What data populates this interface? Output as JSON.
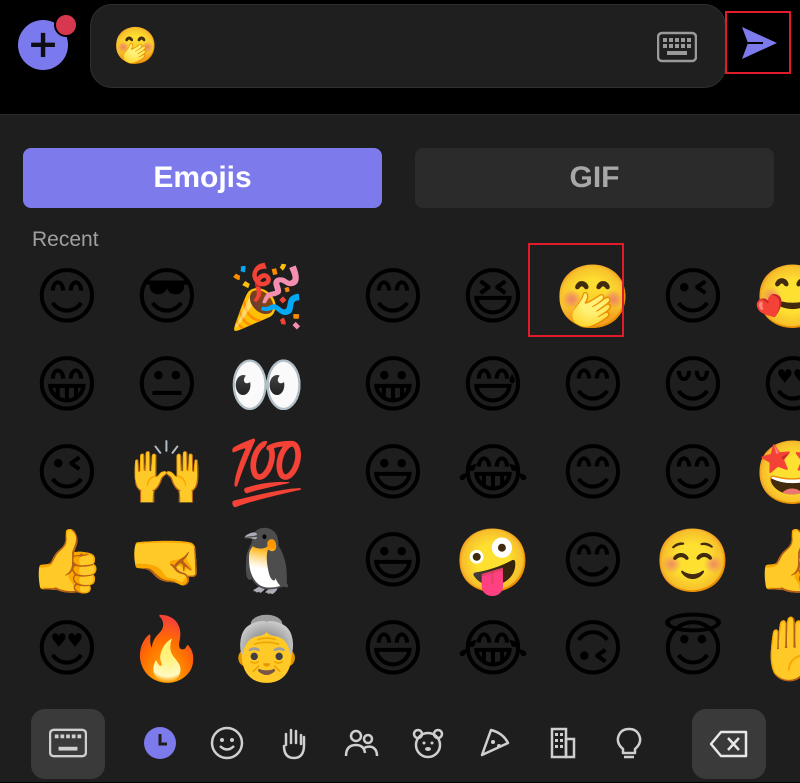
{
  "composer": {
    "input_value": "🤭",
    "icons": {
      "add": "plus-icon",
      "keyboard": "keyboard-icon",
      "send": "send-icon"
    }
  },
  "panel": {
    "tabs": [
      {
        "label": "Emojis",
        "active": true
      },
      {
        "label": "GIF",
        "active": false
      }
    ],
    "section_label": "Recent",
    "emoji_rows": [
      [
        "😊",
        "😎",
        "🎉",
        "😊",
        "😆",
        "🤭",
        "😉",
        "🥰"
      ],
      [
        "😁",
        "😐",
        "👀",
        "😀",
        "😅",
        "😊",
        "😌",
        "😍"
      ],
      [
        "😉",
        "🙌",
        "💯",
        "😃",
        "😂",
        "😊",
        "😊",
        "🤩"
      ],
      [
        "👍",
        "🤜",
        "🐧",
        "😃",
        "🤪",
        "😊",
        "☺️",
        "👍"
      ],
      [
        "😍",
        "🔥",
        "👵",
        "😄",
        "😂",
        "🙃",
        "😇",
        "✋"
      ]
    ],
    "selected_emoji": "🤭",
    "bottom_bar": {
      "left_button": "keyboard-icon",
      "categories": [
        "recent-clock-icon",
        "smiley-icon",
        "hand-icon",
        "people-icon",
        "animal-icon",
        "food-icon",
        "building-icon",
        "lightbulb-icon"
      ],
      "right_button": "backspace-icon"
    }
  },
  "colors": {
    "accent": "#7d7bec",
    "highlight_box": "#e01c2b",
    "panel_bg": "#1e1e1e",
    "notification": "#d8384f"
  }
}
